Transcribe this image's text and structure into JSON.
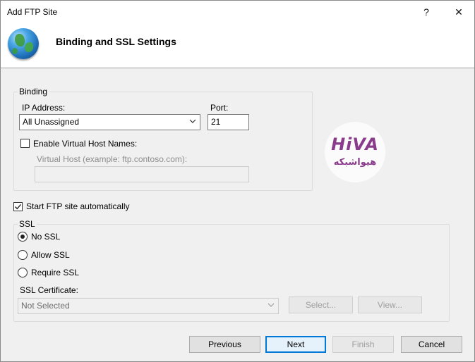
{
  "window": {
    "title": "Add FTP Site",
    "help_glyph": "?",
    "close_glyph": "✕"
  },
  "header": {
    "title": "Binding and SSL Settings",
    "icon": "globe-icon"
  },
  "binding": {
    "group_label": "Binding",
    "ip_label": "IP Address:",
    "ip_value": "All Unassigned",
    "port_label": "Port:",
    "port_value": "21",
    "vhost_checkbox_label": "Enable Virtual Host Names:",
    "vhost_checked": false,
    "vhost_label": "Virtual Host (example: ftp.contoso.com):",
    "vhost_value": ""
  },
  "autostart": {
    "label": "Start FTP site automatically",
    "checked": true
  },
  "ssl": {
    "group_label": "SSL",
    "options": [
      {
        "label": "No SSL",
        "selected": true
      },
      {
        "label": "Allow SSL",
        "selected": false
      },
      {
        "label": "Require SSL",
        "selected": false
      }
    ],
    "cert_label": "SSL Certificate:",
    "cert_value": "Not Selected",
    "select_button": "Select...",
    "view_button": "View..."
  },
  "watermark": {
    "top": "HiVA",
    "bottom": "هیواشبکه"
  },
  "footer": {
    "previous": "Previous",
    "next": "Next",
    "finish": "Finish",
    "cancel": "Cancel"
  },
  "colors": {
    "accent": "#0078d7",
    "watermark": "#8a3b8b"
  }
}
